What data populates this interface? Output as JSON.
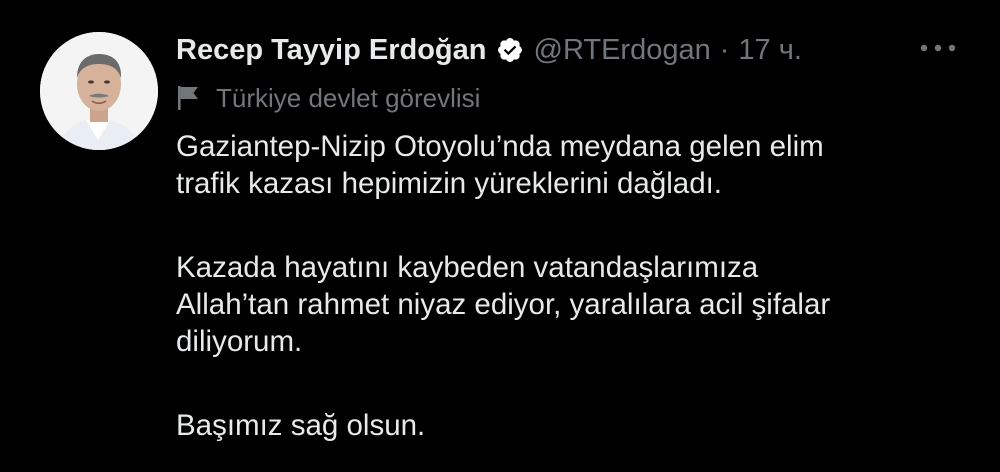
{
  "author": {
    "name": "Recep Tayyip Erdoğan",
    "handle": "@RTErdogan",
    "separator": "·",
    "time": "17 ч.",
    "verified_icon": "verified-badge-icon",
    "label": "Türkiye devlet görevlisi",
    "label_icon": "flag-icon"
  },
  "menu": {
    "icon": "more-icon"
  },
  "tweet": {
    "paragraph1": {
      "line1": "Gaziantep-Nizip Otoyolu’nda meydana gelen elim",
      "line2": "trafik kazası hepimizin yüreklerini dağladı."
    },
    "paragraph2": {
      "line1": "Kazada hayatını kaybeden vatandaşlarımıza",
      "line2": "Allah’tan rahmet niyaz ediyor, yaralılara acil şifalar",
      "line3": "diliyorum."
    },
    "paragraph3": {
      "line1": "Başımız sağ olsun."
    }
  },
  "colors": {
    "background": "#000000",
    "primary_text": "#e7e9ea",
    "secondary_text": "#71767b",
    "badge": "#ffffff"
  }
}
